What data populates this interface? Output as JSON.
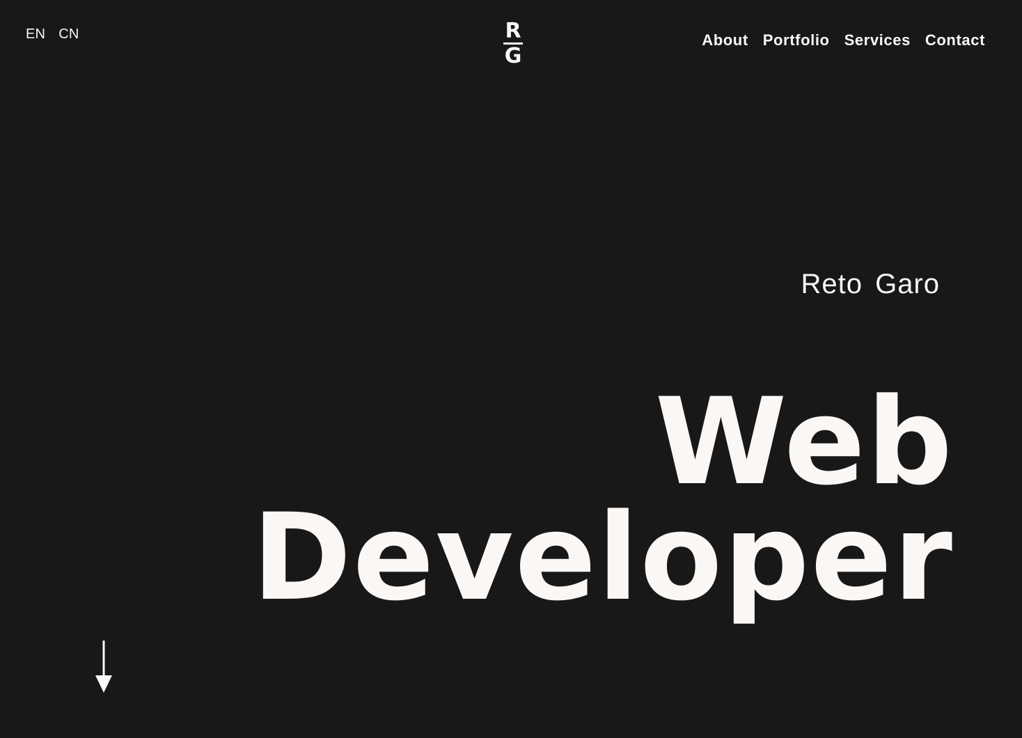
{
  "header": {
    "languages": [
      "EN",
      "CN"
    ],
    "logo": {
      "top": "R",
      "bottom": "G"
    },
    "nav": [
      "About",
      "Portfolio",
      "Services",
      "Contact"
    ]
  },
  "hero": {
    "name": "Reto Garo",
    "title_line1": "Web",
    "title_line2": "Developer"
  },
  "scroll_indicator": {
    "icon": "arrow-down-icon"
  },
  "colors": {
    "background": "#181818",
    "foreground": "#faf7f5"
  }
}
